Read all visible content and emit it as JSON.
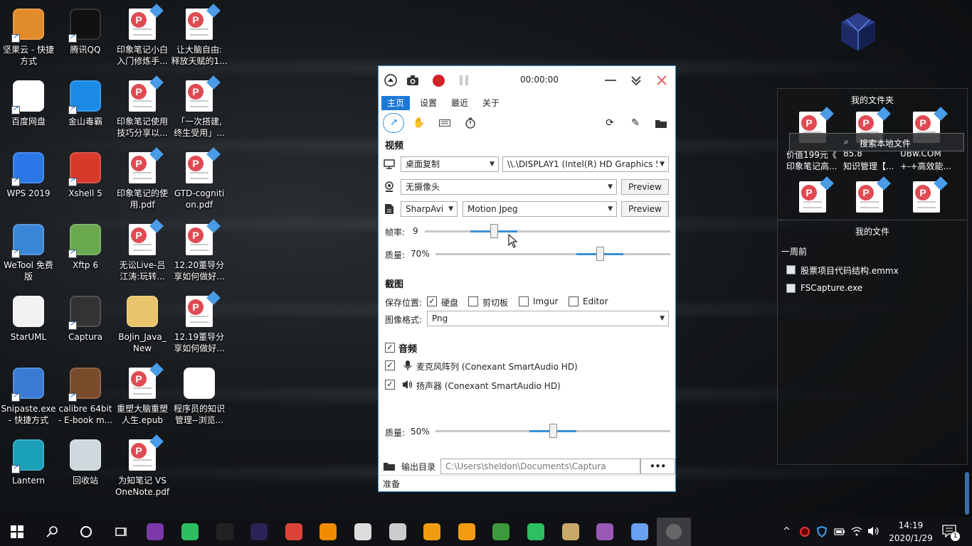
{
  "desktop": {
    "icons": [
      {
        "label": "坚果云 - 快捷\n方式",
        "icon": "nutstore-icon",
        "color": "#e28b2b",
        "shortcut": true
      },
      {
        "label": "腾讯QQ",
        "icon": "qq-penguin-icon",
        "color": "#111111",
        "shortcut": true
      },
      {
        "label": "印象笔记小白\n入门修炼手...",
        "icon": "pdf-file-icon",
        "type": "pdf"
      },
      {
        "label": "让大脑自由:\n释放天赋的1...",
        "icon": "pdf-file-icon",
        "type": "pdf"
      },
      {
        "label": "百度网盘",
        "icon": "baidu-netdisk-icon",
        "color": "#ffffff",
        "shortcut": true
      },
      {
        "label": "金山毒霸",
        "icon": "kingsoft-antivirus-icon",
        "color": "#1a8ae6",
        "shortcut": true
      },
      {
        "label": "印象笔记使用\n技巧分享以...",
        "icon": "pdf-file-icon",
        "type": "pdf"
      },
      {
        "label": "「一次搭建,\n终生受用」...",
        "icon": "pdf-file-icon",
        "type": "pdf"
      },
      {
        "label": "WPS 2019",
        "icon": "wps-icon",
        "color": "#2a77e8",
        "shortcut": true
      },
      {
        "label": "Xshell 5",
        "icon": "xshell-icon",
        "color": "#d8392a",
        "shortcut": true
      },
      {
        "label": "印象笔记的使\n用.pdf",
        "icon": "pdf-file-icon",
        "type": "pdf"
      },
      {
        "label": "GTD-cogniti\non.pdf",
        "icon": "pdf-file-icon",
        "type": "pdf"
      },
      {
        "label": "WeTool 免费\n版",
        "icon": "wetool-icon",
        "color": "#3a86d6",
        "shortcut": true
      },
      {
        "label": "Xftp 6",
        "icon": "xftp-icon",
        "color": "#6aa84f",
        "shortcut": true
      },
      {
        "label": "无讼Live-吕\n江涛:玩转...",
        "icon": "pdf-file-icon",
        "type": "pdf"
      },
      {
        "label": "12.20董导分\n享如何做好...",
        "icon": "pdf-file-icon",
        "type": "pdf"
      },
      {
        "label": "StarUML",
        "icon": "staruml-icon",
        "color": "#f2f2f2",
        "shortcut": false
      },
      {
        "label": "Captura",
        "icon": "captura-icon",
        "color": "#333333",
        "shortcut": true
      },
      {
        "label": "BoJin_Java_\nNew",
        "icon": "zip-folder-icon",
        "color": "#e9c46a",
        "shortcut": false
      },
      {
        "label": "12.19董导分\n享如何做好...",
        "icon": "pdf-file-icon",
        "type": "pdf"
      },
      {
        "label": "Snipaste.exe\n- 快捷方式",
        "icon": "snipaste-icon",
        "color": "#3a7bd5",
        "shortcut": true
      },
      {
        "label": "calibre 64bit\n- E-book m...",
        "icon": "calibre-books-icon",
        "color": "#7a4b2a",
        "shortcut": true
      },
      {
        "label": "重塑大脑重塑\n人生.epub",
        "icon": "pdf-file-icon",
        "type": "pdf"
      },
      {
        "label": "程序员的知识\n管理--浏览...",
        "icon": "webpage-icon",
        "color": "#ffffff",
        "shortcut": false
      },
      {
        "label": "Lantern",
        "icon": "lantern-icon",
        "color": "#1aa0b8",
        "shortcut": true
      },
      {
        "label": "回收站",
        "icon": "recycle-bin-icon",
        "color": "#cfd8dc",
        "shortcut": false
      },
      {
        "label": "为知笔记 VS\nOneNote.pdf",
        "icon": "pdf-file-icon",
        "type": "pdf"
      }
    ]
  },
  "captura": {
    "toolbar": {
      "collapse_icon": "chevron-up-circle-icon",
      "screenshot_icon": "camera-icon",
      "record_icon": "record-icon",
      "pause_icon": "pause-icon",
      "timer": "00:00:00",
      "minimize_icon": "minimize-icon",
      "collapse_down_icon": "double-chevron-down-icon",
      "close_icon": "close-icon",
      "record_color": "#d32029",
      "close_color": "#e6646a"
    },
    "tabs": [
      "主页",
      "设置",
      "最近",
      "关于"
    ],
    "active_tab": "主页",
    "video": {
      "title": "视频",
      "source": "桌面复制",
      "display": "\\\\.\\DISPLAY1 (Intel(R) HD Graphics 5",
      "webcam": "无摄像头",
      "preview_label": "Preview",
      "encoder": "SharpAvi",
      "codec": "Motion Jpeg",
      "framerate_label": "帧率:",
      "framerate_value": "9",
      "framerate_fraction": 0.28,
      "quality_label": "质量:",
      "quality_value": "70%",
      "quality_fraction": 0.7
    },
    "screenshot": {
      "title": "截图",
      "save_label": "保存位置:",
      "targets": [
        {
          "label": "硬盘",
          "checked": true
        },
        {
          "label": "剪切板",
          "checked": false
        },
        {
          "label": "Imgur",
          "checked": false
        },
        {
          "label": "Editor",
          "checked": false
        }
      ],
      "format_label": "图像格式:",
      "format": "Png"
    },
    "audio": {
      "title": "音频",
      "enabled": true,
      "mic": "麦克风阵列 (Conexant SmartAudio HD)",
      "speaker": "扬声器 (Conexant SmartAudio HD)",
      "quality_label": "质量:",
      "quality_value": "50%",
      "quality_fraction": 0.5
    },
    "output": {
      "label": "输出目录",
      "path": "C:\\Users\\sheldon\\Documents\\Captura",
      "more": "•••"
    },
    "status": "准备"
  },
  "right_panel": {
    "folder_title": "我的文件夹",
    "search_overlay": "搜索本地文件",
    "folder_files": [
      {
        "line1": "价值199元《",
        "line2": "印象笔记高..."
      },
      {
        "line1": "85.8",
        "line2": "知识管理【..."
      },
      {
        "line1": "UBw.COM",
        "line2": "+-+高效能..."
      }
    ],
    "files_title": "我的文件",
    "week_label": "一周前",
    "recent_files": [
      {
        "name": "股票项目代码结构.emmx",
        "icon": "emmx-file-icon"
      },
      {
        "name": "FSCapture.exe",
        "icon": "fscapture-icon"
      }
    ]
  },
  "taskbar": {
    "apps": [
      {
        "name": "start-button",
        "icon": "windows-logo-icon",
        "color": "#ffffff"
      },
      {
        "name": "search",
        "icon": "search-icon",
        "color": "#ffffff"
      },
      {
        "name": "cortana",
        "icon": "cortana-circle-icon",
        "color": "#ffffff"
      },
      {
        "name": "task-view",
        "icon": "task-view-icon",
        "color": "#ffffff"
      },
      {
        "name": "onenote",
        "icon": "onenote-icon",
        "color": "#7b3aa8"
      },
      {
        "name": "evernote",
        "icon": "evernote-icon",
        "color": "#2dbe60"
      },
      {
        "name": "intellij",
        "icon": "intellij-icon",
        "color": "#222222"
      },
      {
        "name": "eclipse",
        "icon": "eclipse-icon",
        "color": "#2c2255"
      },
      {
        "name": "chrome",
        "icon": "chrome-icon",
        "color": "#db4437"
      },
      {
        "name": "vlc",
        "icon": "vlc-cone-icon",
        "color": "#f08c00"
      },
      {
        "name": "davinci",
        "icon": "davinci-icon",
        "color": "#dddddd"
      },
      {
        "name": "xmind",
        "icon": "xmind-icon",
        "color": "#cccccc"
      },
      {
        "name": "app-orange",
        "icon": "orange-diamond-icon",
        "color": "#f39c12"
      },
      {
        "name": "search-tool",
        "icon": "magnifier-orange-icon",
        "color": "#f39c12"
      },
      {
        "name": "spreadsheet",
        "icon": "spreadsheet-icon",
        "color": "#3c9a3c"
      },
      {
        "name": "wechat",
        "icon": "wechat-icon",
        "color": "#2dbe60"
      },
      {
        "name": "docs",
        "icon": "document-stack-icon",
        "color": "#c8a96a"
      },
      {
        "name": "datagrip",
        "icon": "datagrip-icon",
        "color": "#9b59b6"
      },
      {
        "name": "app-blue",
        "icon": "blue-cube-icon",
        "color": "#6aa0f0"
      },
      {
        "name": "captura-running",
        "icon": "captura-icon",
        "color": "#666666"
      }
    ],
    "tray": {
      "chevron": "^",
      "time": "14:19",
      "date": "2020/1/29",
      "notification_count": "1"
    }
  }
}
